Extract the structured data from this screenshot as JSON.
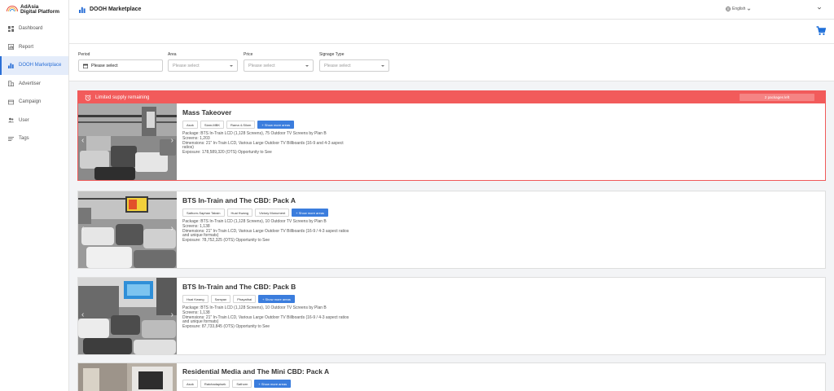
{
  "app": {
    "logo_line1": "AdAsia",
    "logo_line2": "Digital Platform",
    "page_title": "DOOH Marketplace",
    "language": "English"
  },
  "sidebar": {
    "items": [
      {
        "label": "Dashboard",
        "icon": "dashboard-icon",
        "active": false
      },
      {
        "label": "Report",
        "icon": "report-icon",
        "active": false
      },
      {
        "label": "DOOH Marketplace",
        "icon": "bar-chart-icon",
        "active": true
      },
      {
        "label": "Advertiser",
        "icon": "building-icon",
        "active": false
      },
      {
        "label": "Campaign",
        "icon": "campaign-icon",
        "active": false
      },
      {
        "label": "User",
        "icon": "user-icon",
        "active": false
      },
      {
        "label": "Tags",
        "icon": "tags-icon",
        "active": false
      }
    ]
  },
  "filters": {
    "period": {
      "label": "Period",
      "placeholder": "Please select"
    },
    "area": {
      "label": "Area",
      "placeholder": "Please select"
    },
    "price": {
      "label": "Price",
      "placeholder": "Please select"
    },
    "signage": {
      "label": "Signage Type",
      "placeholder": "Please select"
    }
  },
  "supply": {
    "text": "Limited supply remaining",
    "left": "2 packages left",
    "accent": "#f25b5b"
  },
  "more_label": "+ Show more areas",
  "cards": [
    {
      "title": "Mass Takeover",
      "tags": [
        "Asok",
        "Siam-MBK",
        "Rama 4-Silom"
      ],
      "package": "Package: BTS In-Train LCD (1,128 Screens), 75 Outdoor TV Screens by Plan B",
      "screens": "Screens: 1,203",
      "dimensions": "Dimensions: 21\" In-Train LCD, Various Large Outdoor TV Billboards (16-9 and 4-3 aspect ratios)",
      "exposure": "Exposure: 178,589,320 (OTS) Opportunity to See"
    },
    {
      "title": "BTS In-Train and The CBD: Pack A",
      "tags": [
        "Sathorn-Saphan Taksin",
        "Huai Kwang",
        "Victory Monument"
      ],
      "package": "Package: BTS In-Train LCD (1,128 Screens), 10 Outdoor TV Screens by Plan B",
      "screens": "Screens: 1,138",
      "dimensions": "Dimensions: 21\" In-Train LCD, Various Large Outdoor TV Billboards (16-9 / 4-3 aspect ratios and unique formats)",
      "exposure": "Exposure: 78,752,325 (OTS) Opportunity to See"
    },
    {
      "title": "BTS In-Train and The CBD: Pack B",
      "tags": [
        "Huai Kwang",
        "Samyan",
        "Phayathai"
      ],
      "package": "Package: BTS In-Train LCD (1,128 Screens), 10 Outdoor TV Screens by Plan B",
      "screens": "Screens: 1,138",
      "dimensions": "Dimensions: 21\" In-Train LCD, Various Large Outdoor TV Billboards (16-9 / 4-3 aspect ratios and unique formats)",
      "exposure": "Exposure: 87,733,845 (OTS) Opportunity to See"
    },
    {
      "title": "Residential Media and The Mini CBD: Pack A",
      "tags": [
        "Asok",
        "Ratchadapisek",
        "Sathorn"
      ]
    }
  ]
}
